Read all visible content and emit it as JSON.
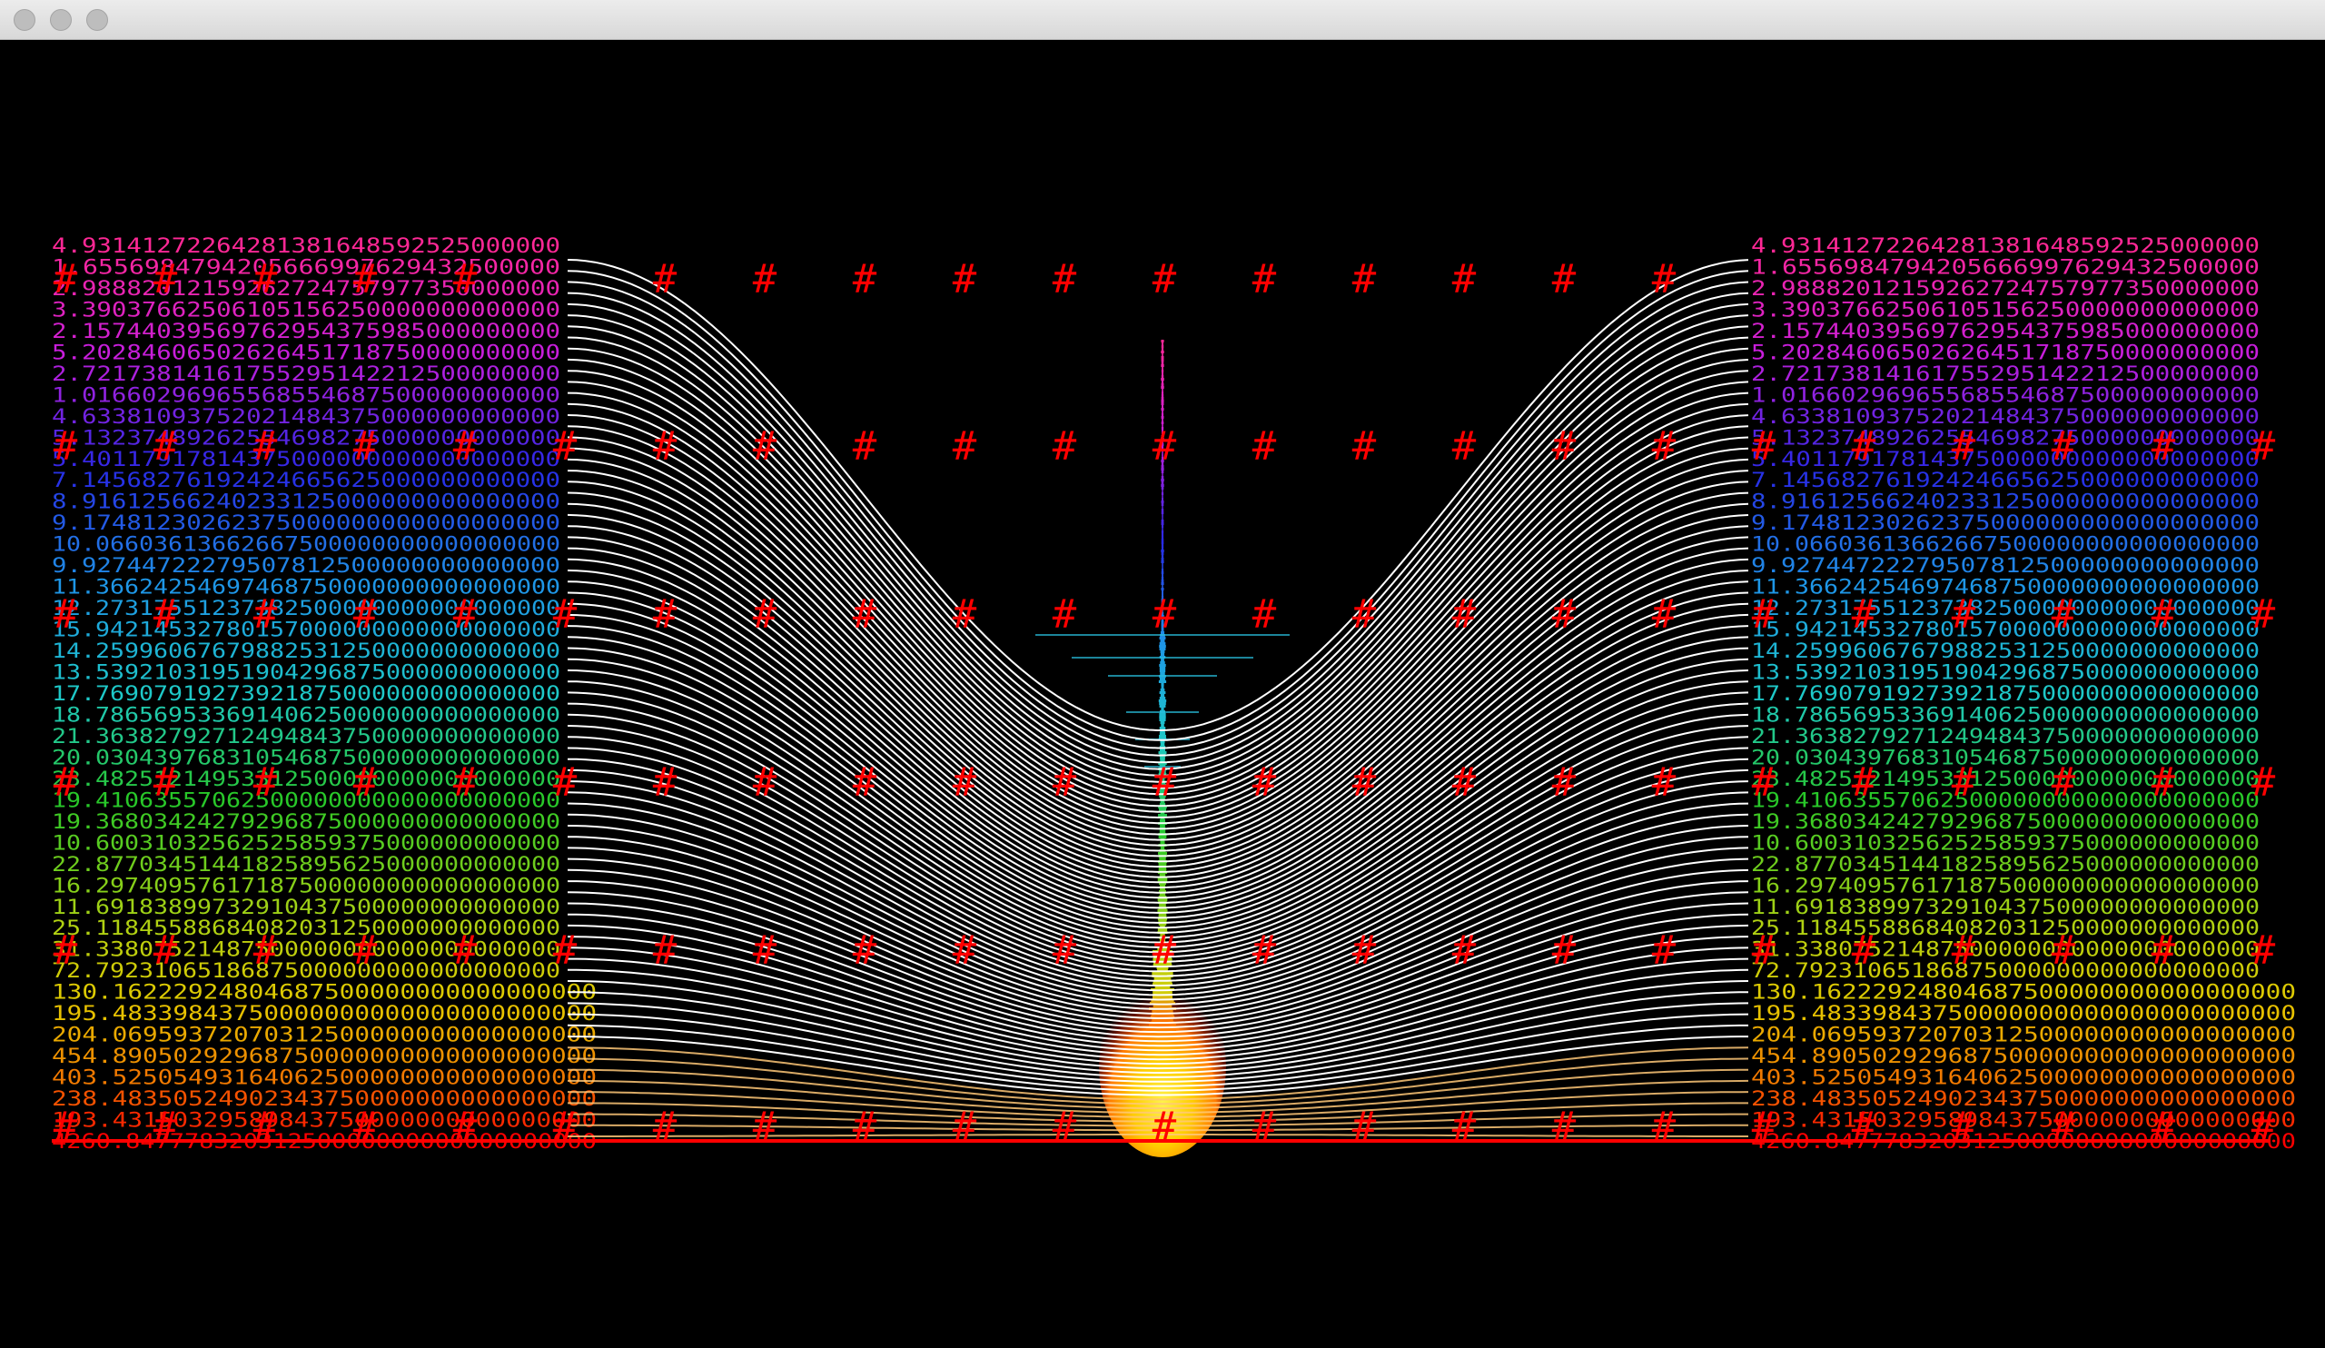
{
  "window": {
    "title": "",
    "buttons": [
      "close",
      "minimize",
      "maximize"
    ]
  },
  "visualization": {
    "left_column_values": [
      "4.93141272264281381648592525000000",
      "1.6556984794205666997629432500000",
      "2.98882012159262724757977350000000",
      "3.39037662506105156250000000000000",
      "2.15744039569762954375985000000000",
      "5.20284606502626451718750000000000",
      "2.72173814161755295142212500000000",
      "1.01660296965568554687500000000000",
      "4.63381093752021484375000000000000",
      "5.13237489262554698275000000000000",
      "5.40117917814375000000000000000000",
      "7.14568276192424665625000000000000",
      "8.91612566240233125000000000000000",
      "9.17481230262375000000000000000000",
      "10.06603613662667500000000000000000",
      "9.92744722279507812500000000000000",
      "11.36624254697468750000000000000000",
      "12.27317551237382500000000000000000",
      "15.94214532780157000000000000000000",
      "14.25996067679882531250000000000000",
      "13.53921031951904296875000000000000",
      "17.76907919273921875000000000000000",
      "18.78656953369140625000000000000000",
      "21.36382792712494843750000000000000",
      "20.03043976831054687500000000000000",
      "23.48251214953312500000000000000000",
      "19.41063557062500000000000000000000",
      "19.36803424279296875000000000000000",
      "10.60031032562525859375000000000000",
      "22.87703451441825895625000000000000",
      "16.29740957617187500000000000000000",
      "11.69183899732910437500000000000000",
      "25.11845588684082031250000000000000",
      "31.33807521487500000000000000000000",
      "72.79231065186875000000000000000000",
      "130.16222924804687500000000000000000",
      "195.48339843750000000000000000000000",
      "204.06959372070312500000000000000000",
      "454.89050292968750000000000000000000",
      "403.52505493164062500000000000000000",
      "238.48350524902343750000000000000000",
      "193.43150329589843750000000000000000",
      "4260.84777832031250000000000000000000"
    ],
    "right_column_values": [
      "4.93141272264281381648592525000000",
      "1.6556984794205666997629432500000",
      "2.98882012159262724757977350000000",
      "3.39037662506105156250000000000000",
      "2.15744039569762954375985000000000",
      "5.20284606502626451718750000000000",
      "2.72173814161755295142212500000000",
      "1.01660296965568554687500000000000",
      "4.63381093752021484375000000000000",
      "5.13237489262554698275000000000000",
      "5.40117917814375000000000000000000",
      "7.14568276192424665625000000000000",
      "8.91612566240233125000000000000000",
      "9.17481230262375000000000000000000",
      "10.06603613662667500000000000000000",
      "9.92744722279507812500000000000000",
      "11.36624254697468750000000000000000",
      "12.27317551237382500000000000000000",
      "15.94214532780157000000000000000000",
      "14.25996067679882531250000000000000",
      "13.53921031951904296875000000000000",
      "17.76907919273921875000000000000000",
      "18.78656953369140625000000000000000",
      "21.36382792712494843750000000000000",
      "20.03043976831054687500000000000000",
      "23.48251214953312500000000000000000",
      "19.41063557062500000000000000000000",
      "19.36803424279296875000000000000000",
      "10.60031032562525859375000000000000",
      "22.87703451441825895625000000000000",
      "16.29740957617187500000000000000000",
      "11.69183899732910437500000000000000",
      "25.11845588684082031250000000000000",
      "31.33807521487500000000000000000000",
      "72.79231065186875000000000000000000",
      "130.16222924804687500000000000000000",
      "195.48339843750000000000000000000000",
      "204.06959372070312500000000000000000",
      "454.89050292968750000000000000000000",
      "403.52505493164062500000000000000000",
      "238.48350524902343750000000000000000",
      "193.43150329589843750000000000000000",
      "4260.84777832031250000000000000000000"
    ],
    "marker_glyph": "#",
    "curve_count": 80,
    "colors": {
      "background": "#000000",
      "curves": "#ffffff",
      "markers": "#ff0000",
      "text_gradient_top": "#ff2a6a",
      "text_gradient_bottom": "#ff0000"
    }
  }
}
